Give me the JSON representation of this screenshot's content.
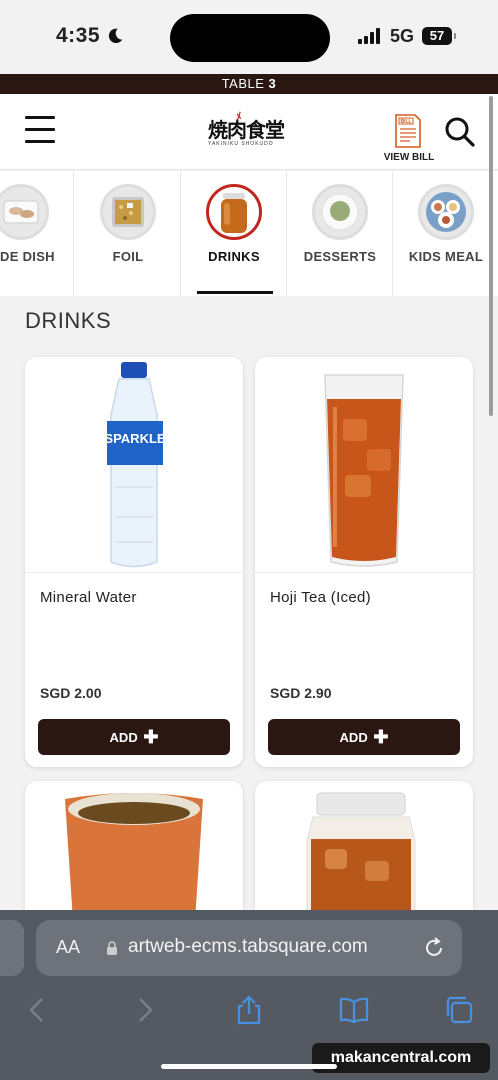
{
  "status": {
    "time": "4:35",
    "network": "5G",
    "battery": "57"
  },
  "table": {
    "prefix": "TABLE",
    "number": "3"
  },
  "header": {
    "logo_text": "焼肉食堂",
    "logo_subtext": "YAKINIKU SHOKUDO",
    "bill_icon_text": "BILL",
    "view_bill_label": "VIEW BILL"
  },
  "categories": [
    {
      "label": "SIDE DISH",
      "icon": "side-dish-thumb"
    },
    {
      "label": "FOIL",
      "icon": "foil-thumb"
    },
    {
      "label": "DRINKS",
      "icon": "drinks-thumb",
      "active": true
    },
    {
      "label": "DESSERTS",
      "icon": "desserts-thumb"
    },
    {
      "label": "KIDS MEAL",
      "icon": "kids-meal-thumb"
    }
  ],
  "section": {
    "title": "DRINKS"
  },
  "products": [
    {
      "name": "Mineral Water",
      "price": "SGD 2.00",
      "add_label": "ADD",
      "bottle_label": "SPARKLE"
    },
    {
      "name": "Hoji Tea (Iced)",
      "price": "SGD 2.90",
      "add_label": "ADD"
    },
    {
      "name": "",
      "price": "",
      "add_label": ""
    },
    {
      "name": "",
      "price": "",
      "add_label": ""
    }
  ],
  "browser": {
    "aa_label": "AA",
    "url": "artweb-ecms.tabsquare.com"
  },
  "watermark": "makancentral.com",
  "colors": {
    "brand_dark": "#2a1711",
    "accent_red": "#c0281f",
    "safari_bar": "#555a62",
    "ios_blue": "#4a90e2"
  }
}
